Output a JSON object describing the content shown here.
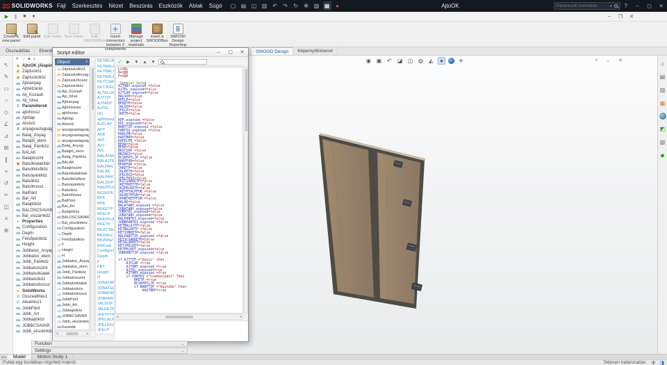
{
  "colors": {
    "brand_red": "#e2231a",
    "keyword_blue": "#2e9bd6",
    "wood": "#98826a",
    "frame": "#4e4a45",
    "titlebar_bg": "#14191f"
  },
  "titlebar": {
    "brand_mark": "ЗS",
    "brand_name": "SOLIDWORKS",
    "menus": [
      {
        "label": "Fájl"
      },
      {
        "label": "Szerkesztés"
      },
      {
        "label": "Nézet"
      },
      {
        "label": "Beszúrás"
      },
      {
        "label": "Eszközök"
      },
      {
        "label": "Ablak"
      },
      {
        "label": "Súgó"
      }
    ],
    "icons": [
      {
        "name": "new-doc-icon",
        "glyph": "▢"
      },
      {
        "name": "open-icon",
        "glyph": "▤"
      },
      {
        "name": "save-icon",
        "glyph": "◫"
      },
      {
        "name": "print-icon",
        "glyph": "▥"
      },
      {
        "name": "undo-icon",
        "glyph": "↶"
      },
      {
        "name": "redo-icon",
        "glyph": "↷"
      },
      {
        "name": "rebuild-icon",
        "glyph": "↻"
      },
      {
        "name": "options-icon",
        "glyph": "✻"
      },
      {
        "name": "file-properties-icon",
        "glyph": "▧"
      },
      {
        "name": "macro-icon",
        "glyph": "▦",
        "cls": "active"
      },
      {
        "name": "record-icon",
        "glyph": "●",
        "cls": "red"
      }
    ],
    "doc_title": "AjtoOK",
    "search_placeholder": "Parancsok keresése",
    "help_glyph": "?",
    "window_controls": [
      {
        "name": "minimize-icon",
        "glyph": "–"
      },
      {
        "name": "maximize-icon",
        "glyph": "▢"
      },
      {
        "name": "close-icon",
        "glyph": "✕"
      }
    ]
  },
  "macro_toolbar": {
    "icons": [
      {
        "name": "macro-run-icon",
        "glyph": "▶",
        "cls": "green"
      },
      {
        "name": "macro-pause-icon",
        "glyph": "∥"
      },
      {
        "name": "macro-stop-icon",
        "glyph": "■"
      },
      {
        "name": "macro-record-icon",
        "glyph": "●",
        "cls": "red"
      }
    ],
    "doc_controls": [
      {
        "name": "doc-minimize-icon",
        "glyph": "‒"
      },
      {
        "name": "doc-restore-icon",
        "glyph": "❐"
      },
      {
        "name": "doc-close-icon",
        "glyph": "✕"
      }
    ]
  },
  "ribbon": {
    "buttons": [
      {
        "label": "Create a new panel",
        "icon": "new-panel",
        "state": ""
      },
      {
        "label": "Edit panel",
        "icon": "edit-panel",
        "state": ""
      },
      {
        "label": "Edit frame",
        "icon": "edit-frame",
        "state": "disabled"
      },
      {
        "label": "New frame",
        "icon": "new-frame",
        "state": "disabled"
      },
      {
        "label": "Edit SWOODBox",
        "icon": "edit-box",
        "state": "disabled"
      },
      {
        "label": "Insert connectors between 2 components",
        "icon": "connectors",
        "state": "",
        "wide": "wide"
      },
      {
        "label": "Manage project materials",
        "icon": "materials",
        "state": ""
      },
      {
        "label": "Insert a SWOODBox",
        "icon": "swoodbox",
        "state": ""
      },
      {
        "label": "SWOOD Design Reporting",
        "icon": "reporting",
        "state": ""
      }
    ]
  },
  "command_tabs": {
    "left": [
      {
        "label": "Összeállítás",
        "state": ""
      },
      {
        "label": "Elrendezés",
        "state": ""
      }
    ],
    "right": [
      {
        "label": "SWOOD Design",
        "state": "active"
      },
      {
        "label": "Képernyőkimenet",
        "state": ""
      }
    ]
  },
  "left_toolbar": {
    "icons": [
      {
        "name": "select-icon",
        "glyph": "↖"
      },
      {
        "name": "sketch-icon",
        "glyph": "✎"
      },
      {
        "name": "rect-icon",
        "glyph": "▭"
      },
      {
        "name": "circle-icon",
        "glyph": "○"
      },
      {
        "name": "polygon-icon",
        "glyph": "◇"
      },
      {
        "name": "angle-icon",
        "glyph": "∠"
      },
      {
        "name": "dimension-icon",
        "glyph": "⊿"
      },
      {
        "name": "pattern-icon",
        "glyph": "⊞"
      },
      {
        "name": "mirror-icon",
        "glyph": "∥"
      },
      {
        "name": "target-icon",
        "glyph": "⌖"
      },
      {
        "name": "rotate-icon",
        "glyph": "↺"
      },
      {
        "name": "trim-icon",
        "glyph": "✂"
      },
      {
        "name": "layers-icon",
        "glyph": "◫"
      },
      {
        "name": "grid-icon",
        "glyph": "≡"
      },
      {
        "name": "add-icon",
        "glyph": "⊕"
      }
    ]
  },
  "feature_tree": {
    "toolbar": [
      {
        "name": "tree-display-icon",
        "glyph": "▼"
      },
      {
        "name": "tree-filter-icon",
        "glyph": "▽"
      },
      {
        "name": "tree-pin-icon",
        "glyph": "◆"
      },
      {
        "name": "tree-options-icon",
        "glyph": "≡"
      }
    ],
    "items": [
      {
        "icon": "ic-asm",
        "label": "AjtoOK (Alapért.)",
        "style": "bold"
      },
      {
        "icon": "ic-cube",
        "label": "Záptuskó1",
        "style": ""
      },
      {
        "icon": "ic-cube",
        "label": "Záptuskóköz",
        "style": ""
      },
      {
        "icon": "ic-ab",
        "label": "Ajtóanyag",
        "style": ""
      },
      {
        "icon": "ic-ab",
        "label": "Ajtóélzárás",
        "style": ""
      },
      {
        "icon": "ic-ab",
        "label": "Alj_Kozault",
        "style": ""
      },
      {
        "icon": "ic-ab",
        "label": "Alj_tolva",
        "style": ""
      },
      {
        "icon": "ic-param",
        "label": "Paraméterek",
        "style": "bold"
      },
      {
        "icon": "ic-ab",
        "label": "ajtóhossz",
        "style": ""
      },
      {
        "icon": "ic-ab",
        "label": "Ajtólap",
        "style": ""
      },
      {
        "icon": "ic-ab",
        "label": "Alsóviz",
        "style": ""
      },
      {
        "icon": "ic-xgreen",
        "label": "anyagvastagság",
        "style": ""
      },
      {
        "icon": "ic-ab",
        "label": "Balaj_Anyag",
        "style": ""
      },
      {
        "icon": "ic-ab",
        "label": "Balajtó_elem",
        "style": ""
      },
      {
        "icon": "ic-ab",
        "label": "Balaj_Pántköz",
        "style": ""
      },
      {
        "icon": "ic-ab",
        "label": "BALAK",
        "style": ""
      },
      {
        "icon": "ic-ab",
        "label": "Balajtószint",
        "style": ""
      },
      {
        "icon": "ic-orange",
        "label": "Balsókialakítás",
        "style": ""
      },
      {
        "icon": "ic-ab",
        "label": "Balsófelsőköz",
        "style": ""
      },
      {
        "icon": "ic-ab",
        "label": "Balsópántköz",
        "style": ""
      },
      {
        "icon": "ic-ab",
        "label": "Balsóköz",
        "style": ""
      },
      {
        "icon": "ic-ab",
        "label": "Balsóhossz",
        "style": ""
      },
      {
        "icon": "ic-ab",
        "label": "BalPánt",
        "style": ""
      },
      {
        "icon": "ic-ab",
        "label": "Bal_Art",
        "style": ""
      },
      {
        "icon": "ic-ab",
        "label": "Balajtóköz",
        "style": ""
      },
      {
        "icon": "ic-ab",
        "label": "BALOSCSAVAR",
        "style": ""
      },
      {
        "icon": "ic-ab",
        "label": "Bal_elszámköz",
        "style": ""
      },
      {
        "icon": "ic-fold",
        "label": "Properties",
        "style": "bold"
      },
      {
        "icon": "ic-ab",
        "label": "Configuration",
        "style": ""
      },
      {
        "icon": "ic-ab",
        "label": "Depth",
        "style": ""
      },
      {
        "icon": "ic-ab",
        "label": "Felsőpántköz",
        "style": ""
      },
      {
        "icon": "ic-ab",
        "label": "Height",
        "style": ""
      },
      {
        "icon": "ic-ab",
        "label": "Jobbalsó_Anyag",
        "style": ""
      },
      {
        "icon": "ic-ab",
        "label": "Jobbalsó_elem",
        "style": ""
      },
      {
        "icon": "ic-ab",
        "label": "Jobb_Pántköz",
        "style": ""
      },
      {
        "icon": "ic-ab",
        "label": "Jobbalsószint",
        "style": ""
      },
      {
        "icon": "ic-ab",
        "label": "Jobbalsókialak",
        "style": ""
      },
      {
        "icon": "ic-ab",
        "label": "Jobbalsóköz",
        "style": ""
      },
      {
        "icon": "ic-ab",
        "label": "Jobbalsóhossz",
        "style": ""
      },
      {
        "icon": "ic-fold",
        "label": "SolidWorks",
        "style": "bold"
      },
      {
        "icon": "ic-check",
        "label": "Összeállítás1",
        "style": ""
      },
      {
        "icon": "ic-check",
        "label": "Alkatrész1",
        "style": ""
      },
      {
        "icon": "ic-ab",
        "label": "JobbPánt",
        "style": ""
      },
      {
        "icon": "ic-ab",
        "label": "Jobb_Art",
        "style": ""
      },
      {
        "icon": "ic-ab",
        "label": "Jobbajtóköz",
        "style": ""
      },
      {
        "icon": "ic-ab",
        "label": "JOBBCSAVAR",
        "style": ""
      },
      {
        "icon": "ic-ab",
        "label": "Jobb_elszámköz",
        "style": ""
      }
    ]
  },
  "script_editor": {
    "title": "Script editor",
    "controls": [
      {
        "name": "window-minimize-icon",
        "glyph": "–"
      },
      {
        "name": "window-maximize-icon",
        "glyph": "▢"
      },
      {
        "name": "window-close-icon",
        "glyph": "✕"
      }
    ],
    "object_dropdown": "Object",
    "object_caret": "▾",
    "toolbar_icons": [
      {
        "name": "validate-icon",
        "glyph": "✓",
        "cls": "green"
      },
      {
        "name": "run-script-icon",
        "glyph": "▶",
        "cls": "green"
      },
      {
        "name": "filter-icon",
        "glyph": "▼"
      },
      {
        "name": "up-icon",
        "glyph": "▲"
      },
      {
        "name": "down-icon",
        "glyph": "▼"
      }
    ],
    "search_value": "",
    "objects": [
      {
        "icon": "ic-fx",
        "label": "ZáptuskóAnt1"
      },
      {
        "icon": "ic-fx",
        "label": "ZáptuskóAnyag"
      },
      {
        "icon": "ic-fx",
        "label": "Záptuskóhossz"
      },
      {
        "icon": "ic-fx",
        "label": "Záptuskóköz"
      },
      {
        "icon": "ic-ab",
        "label": "Ajs_Kozault"
      },
      {
        "icon": "ic-ab",
        "label": "Ajs_tolva"
      },
      {
        "icon": "ic-ab",
        "label": "Ajtóanyag"
      },
      {
        "icon": "ic-ab",
        "label": "Ajtóélzárás"
      },
      {
        "icon": "ic-fx",
        "label": "ajtóhossz"
      },
      {
        "icon": "ic-ab",
        "label": "Ajtólap"
      },
      {
        "icon": "ic-ab",
        "label": "Alsóviz"
      },
      {
        "icon": "ic-fx",
        "label": "anyagvastagság"
      },
      {
        "icon": "ic-fx",
        "label": "anyagvastagság2"
      },
      {
        "icon": "ic-fx",
        "label": "anyagvastagság3"
      },
      {
        "icon": "ic-ab",
        "label": "Balaj_Anyag"
      },
      {
        "icon": "ic-ab",
        "label": "Balajtó_elem"
      },
      {
        "icon": "ic-ab",
        "label": "Balaj_Pántköz"
      },
      {
        "icon": "ic-ab",
        "label": "BALAK"
      },
      {
        "icon": "ic-ab",
        "label": "Balajtószint"
      },
      {
        "icon": "ic-ab",
        "label": "Balsókialakítás"
      },
      {
        "icon": "ic-num",
        "label": "Balsófelsőköz"
      },
      {
        "icon": "ic-num",
        "label": "Balsópántköz"
      },
      {
        "icon": "ic-num",
        "label": "Balsóköz"
      },
      {
        "icon": "ic-num",
        "label": "Balsóhossz"
      },
      {
        "icon": "ic-ab",
        "label": "BalPánt"
      },
      {
        "icon": "ic-ab",
        "label": "Bal_Art"
      },
      {
        "icon": "ic-num",
        "label": "Balajtóköz"
      },
      {
        "icon": "ic-ab",
        "label": "BALOSCSAVAR"
      },
      {
        "icon": "ic-num",
        "label": "Bal_elszámköz"
      },
      {
        "icon": "ic-ab",
        "label": "Configuration"
      },
      {
        "icon": "ic-num",
        "label": "Depth"
      },
      {
        "icon": "ic-num",
        "label": "Felsőpántköz"
      },
      {
        "icon": "ic-num",
        "label": "F"
      },
      {
        "icon": "ic-num",
        "label": "Height"
      },
      {
        "icon": "ic-num",
        "label": "H"
      },
      {
        "icon": "ic-ab",
        "label": "Jobbalsó_Anyag"
      },
      {
        "icon": "ic-ab",
        "label": "Jobbalsó_elem"
      },
      {
        "icon": "ic-ab",
        "label": "Jobb_Pántköz"
      },
      {
        "icon": "ic-ab",
        "label": "Jobbalsószint"
      },
      {
        "icon": "ic-ab",
        "label": "Jobbalsókialak"
      },
      {
        "icon": "ic-num",
        "label": "Jobbalsóköz"
      },
      {
        "icon": "ic-num",
        "label": "Jobbalsóhossz"
      },
      {
        "icon": "ic-ab",
        "label": "JobbPánt"
      },
      {
        "icon": "ic-ab",
        "label": "Jobb_Art"
      },
      {
        "icon": "ic-num",
        "label": "Jobbajtóköz"
      },
      {
        "icon": "ic-ab",
        "label": "JOBBCSAVAR"
      },
      {
        "icon": "ic-num",
        "label": "Jobb_elszámköz"
      },
      {
        "icon": "ic-ab",
        "label": "Kautobk"
      }
    ],
    "keywords": [
      "KETALUKKET",
      "KETBALAJT",
      "KETBALSOTIP",
      "KETBALFELKET",
      "KETCSAKKETP",
      "KETJFELKET",
      "ALTKLUFT",
      "AJTTIP",
      "AJTANY",
      "AJTEL",
      "HG",
      "ajtóhossz",
      "AJTLAP",
      "APT",
      "AVB",
      "AVF",
      "AVJ",
      "AVL",
      "BALATANY",
      "BALAJTEL",
      "BALPANTKI",
      "BALAK",
      "BALPANTTIP",
      "BALSOP",
      "BAKPFUR",
      "BCSKPELLIP",
      "BFK",
      "BPK",
      "BFKETP",
      "BFELP",
      "BFKPFUR",
      "BKETP",
      "BKZCSKP",
      "BKZAKZ",
      "BKZKNZ",
      "BhfCsel",
      "Configuration",
      "Depth",
      "F",
      "FBT",
      "Height",
      "H",
      "JOBATANY",
      "JOBATEL",
      "JOBBPANTKI",
      "JOBPANTTIP",
      "JALSOP",
      "JALKETPFUR",
      "JKETPTALPFUR",
      "JPELALKIZ",
      "JPELFKOZ",
      "JFELP"
    ],
    "code": [
      "L=SBL",
      "H=SBH",
      "F=SBP",
      "",
      "'General Setup",
      "AJTANY.exposed =false",
      "AJTEL.exposed=false",
      "AJTLAP.exposed=false",
      "BALSOP=false",
      "BFELP=false",
      "BFKETP=false",
      "JALSOP=false",
      "JFELP=false",
      "JKETP=false",
      "",
      "KPF.exposed =false",
      "KPL.exposed=false",
      "BANTTIP.exposed =false",
      "PANTIG.exposed =false",
      "KAALPB=false",
      "KAUTBKP=false",
      "KAPELPB =false",
      "BFAK=false",
      "BFKK=false",
      "BKZCSKP =false",
      "BKZAKZ=false",
      "BCSKPPTLJP =false",
      "BAKPFUR=false",
      "BFKPFUR =false",
      "JAKETP=false",
      "JALKETP=false",
      "JPELKOZ=false",
      "JPELFKOZ=false",
      "JKZCSAKKETP=false",
      "JKETPKETTE=false",
      "JKZPELKETP=false",
      "JKETPTALPFUR =false",
      "JALKETPFUR=false",
      "JPANTKETPFUR =false",
      "BALAK=false",
      "BALATANY.exposed =false",
      "JOBATANY.exposed=false",
      "JOBATEL.exposed=false",
      "JOBATANY.exposed=false",
      "BALPANTKI.exposed=false",
      "JOBBPANTKI.exposed =false",
      "KETBALAJTP=false",
      "KETBALKETP =false",
      "KETJOBKETP=false",
      "BALPANTTIP.exposed =false",
      "KETJCSAKKETP=false",
      "KETALUKKET=false",
      "KETJPELKET=false",
      "KETPELKET.exposed=false",
      "JOBPANTTIP.exposed =false",
      "",
      "if AJTTIP =\"basic\" then",
      "    AJTLAP =true",
      "    AJTANY.exposed =true",
      "    AJTEL.exposed=true",
      "    AJTANY.exposed =true",
      "    if PANTKI =\"Csakketpánt\" Then",
      "        BKETP =true",
      "        BCSKPPTLJP =true",
      "        if BANTTIP =\"Kautobk\" then",
      "            KAUTBKP=true"
    ]
  },
  "headsup": {
    "icons": [
      {
        "name": "zoom-fit-icon",
        "glyph": "◉",
        "cls": ""
      },
      {
        "name": "zoom-area-icon",
        "glyph": "▣",
        "cls": ""
      },
      {
        "name": "previous-view-icon",
        "glyph": "↶",
        "cls": ""
      },
      {
        "name": "section-view-icon",
        "glyph": "◪",
        "cls": ""
      },
      {
        "name": "view-orientation-icon",
        "glyph": "◫",
        "cls": ""
      },
      {
        "name": "display-style-icon",
        "glyph": "◍",
        "cls": ""
      },
      {
        "name": "hide-show-icon",
        "glyph": "◭",
        "cls": ""
      },
      {
        "name": "realview-icon",
        "glyph": "●",
        "cls": "active"
      },
      {
        "name": "appearances-icon",
        "glyph": "",
        "cls": "ball"
      },
      {
        "name": "scene-icon",
        "glyph": "☀",
        "cls": ""
      }
    ],
    "pane_controls": [
      {
        "name": "collapse-pane-icon",
        "glyph": "«"
      },
      {
        "name": "pin-pane-icon",
        "glyph": "⌄"
      },
      {
        "name": "close-pane-icon",
        "glyph": "✕"
      }
    ]
  },
  "task_pane": {
    "icons": [
      {
        "name": "resources-icon",
        "glyph": "⌂",
        "cls": "blue"
      },
      {
        "name": "design-library-icon",
        "glyph": "▤",
        "cls": ""
      },
      {
        "name": "file-explorer-icon",
        "glyph": "▥",
        "cls": ""
      },
      {
        "name": "view-palette-icon",
        "glyph": "▦",
        "cls": "orange"
      },
      {
        "name": "appearances-ball-icon",
        "glyph": "●",
        "cls": "ball"
      },
      {
        "name": "scenes-icon",
        "glyph": "◩",
        "cls": "green"
      },
      {
        "name": "custom-properties-icon",
        "glyph": "▧",
        "cls": ""
      },
      {
        "name": "swood-pane-icon",
        "glyph": "◆",
        "cls": "green"
      }
    ]
  },
  "bottom_panels": [
    {
      "label": "Function",
      "chevron": "⌄"
    },
    {
      "label": "Settings",
      "chevron": "⌄"
    }
  ],
  "doc_tabs": {
    "nav": [
      {
        "name": "tabs-scroll-left-icon",
        "glyph": "◂"
      },
      {
        "name": "tabs-scroll-right-icon",
        "glyph": "▸"
      }
    ],
    "tabs": [
      {
        "label": "Model",
        "state": "active"
      },
      {
        "label": "Motion Study 1",
        "state": ""
      }
    ]
  },
  "statusbar": {
    "left": "Futtat egy korábban rögzített makrót.",
    "right": "Teljesen határozatlan",
    "icons": [
      {
        "name": "status-options-icon",
        "glyph": "✻",
        "cls": ""
      },
      {
        "name": "task-pane-toggle-icon",
        "glyph": "◨",
        "cls": "blue"
      }
    ]
  }
}
